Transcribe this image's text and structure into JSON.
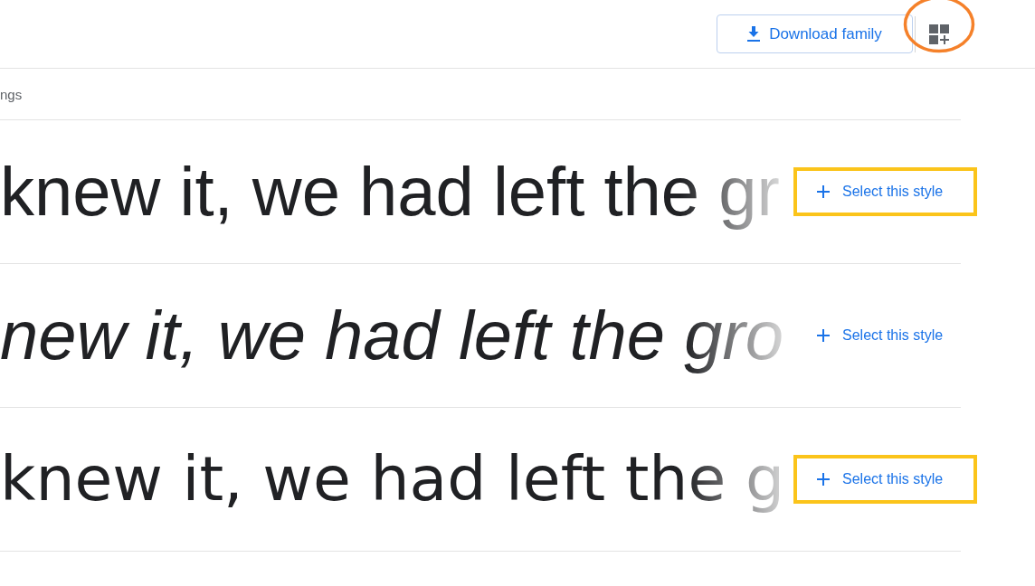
{
  "header": {
    "download_button": {
      "label": "Download family"
    },
    "collection_button": {
      "circled": true
    }
  },
  "section": {
    "label": "ngs"
  },
  "styles": [
    {
      "sample": "knew it, we had left the gr",
      "kind": "light",
      "italic": false,
      "button": "Select this style",
      "highlighted": true
    },
    {
      "sample": "new it, we had left the gro",
      "kind": "light",
      "italic": true,
      "button": "Select this style",
      "highlighted": false
    },
    {
      "sample": "knew it, we had left the g",
      "kind": "regular",
      "italic": false,
      "button": "Select this style",
      "highlighted": true
    }
  ]
}
